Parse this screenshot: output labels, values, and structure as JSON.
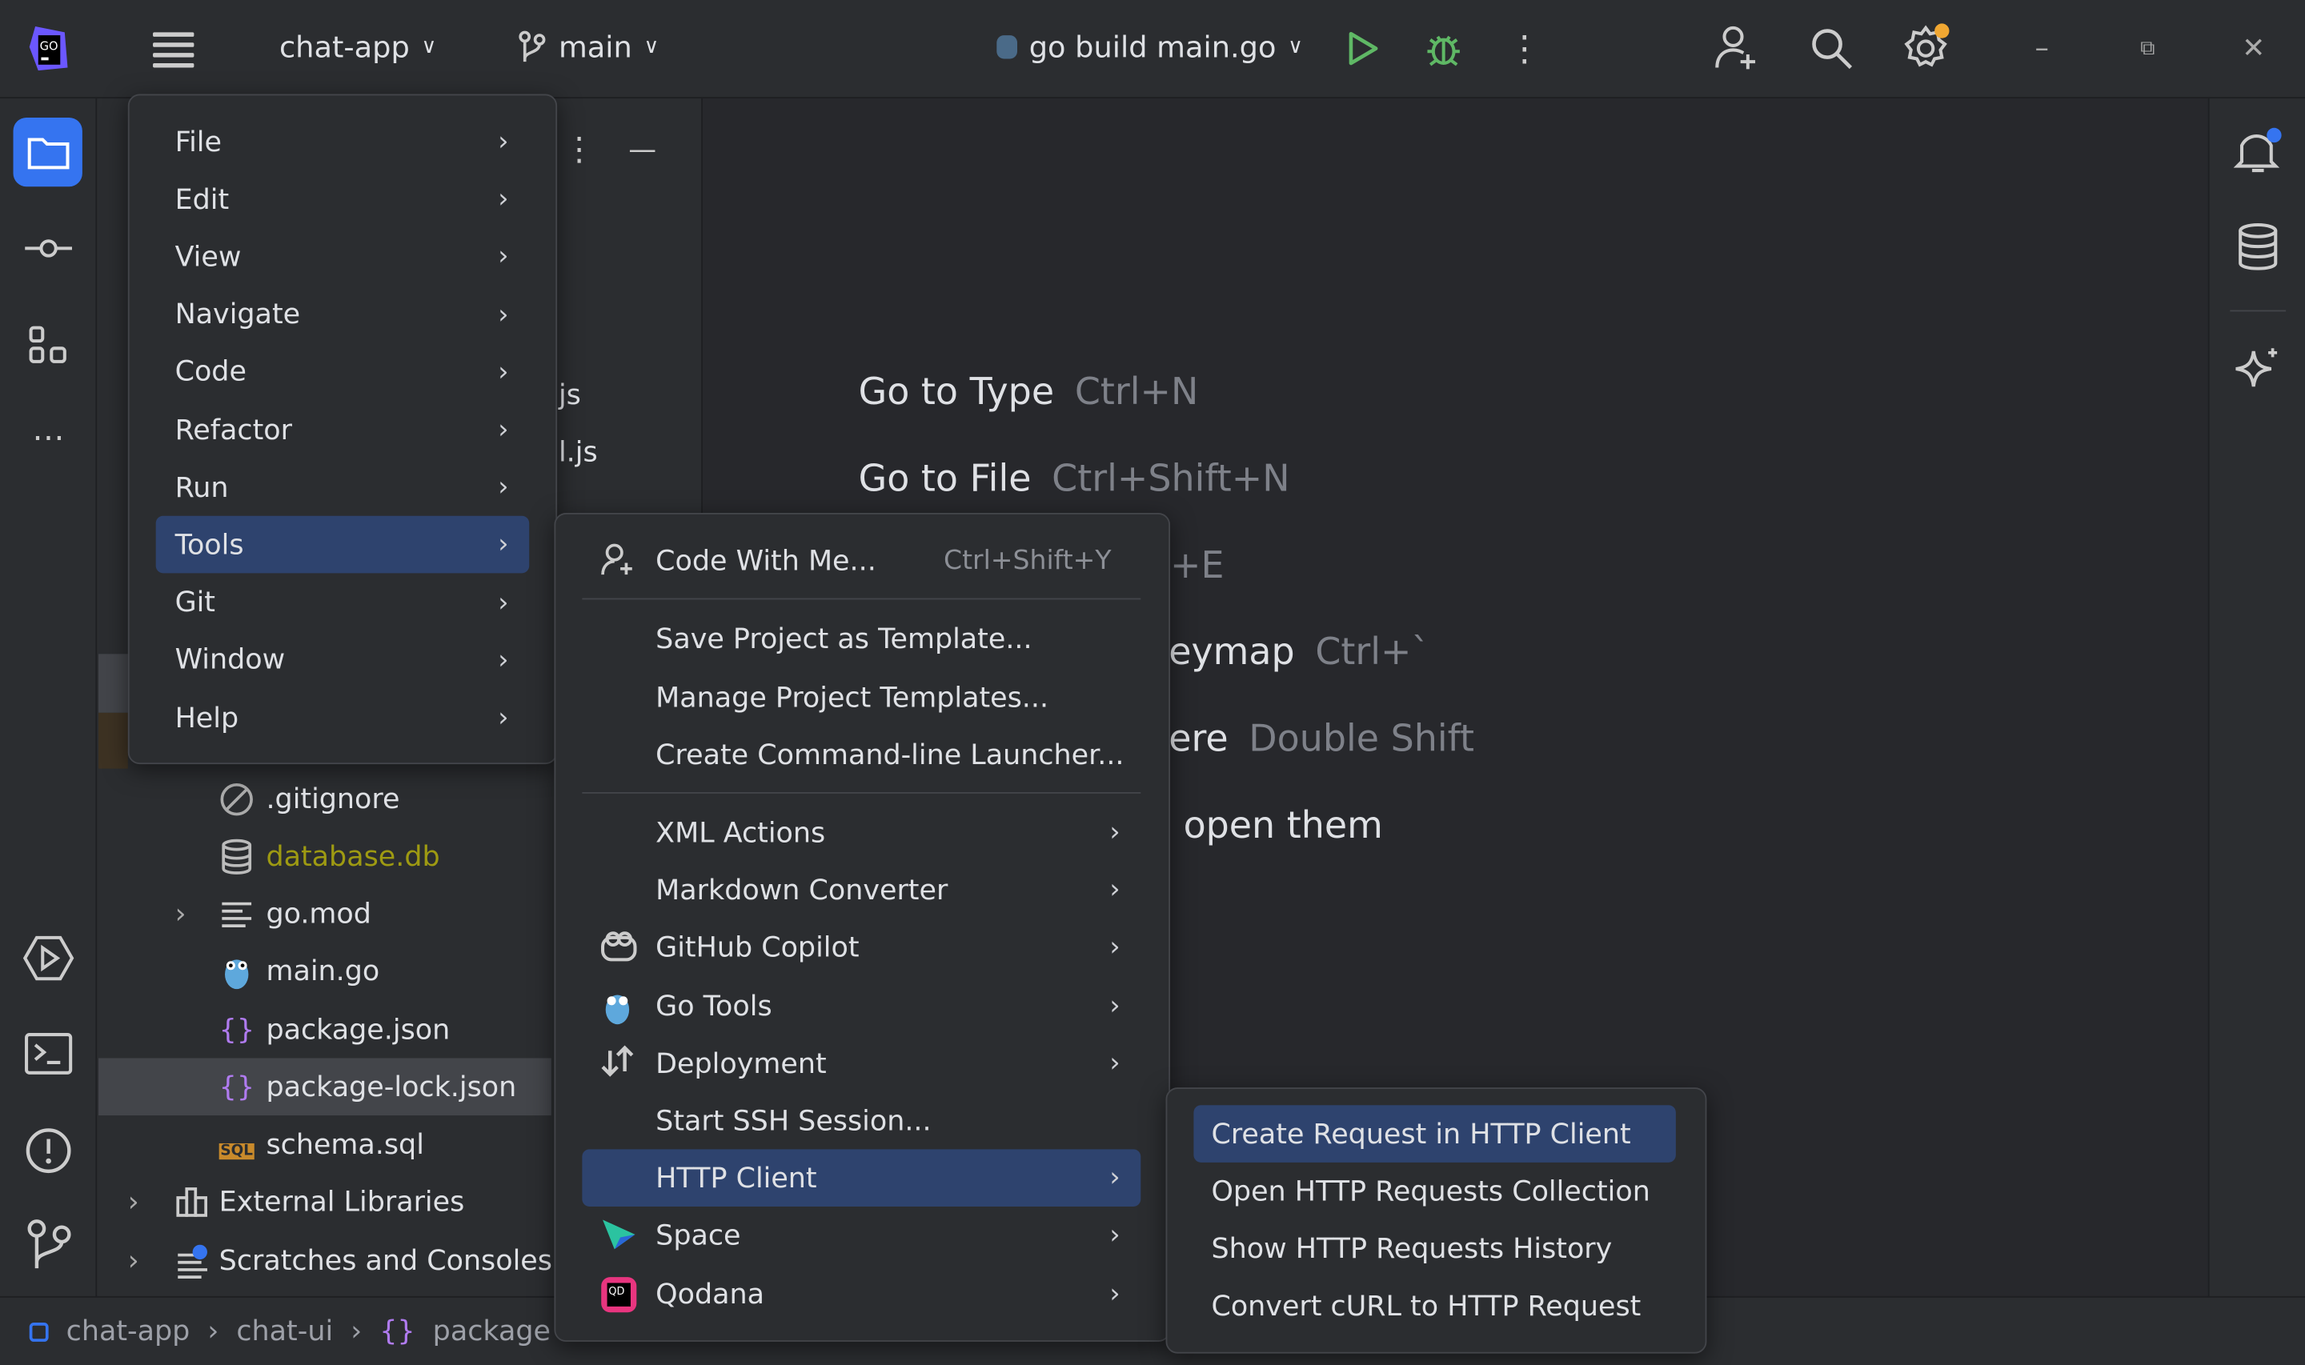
{
  "topbar": {
    "project": "chat-app",
    "branch": "main",
    "run_config": "go build main.go"
  },
  "main_menu": {
    "items": [
      {
        "label": "File"
      },
      {
        "label": "Edit"
      },
      {
        "label": "View"
      },
      {
        "label": "Navigate"
      },
      {
        "label": "Code"
      },
      {
        "label": "Refactor"
      },
      {
        "label": "Run"
      },
      {
        "label": "Tools",
        "selected": true
      },
      {
        "label": "Git"
      },
      {
        "label": "Window"
      },
      {
        "label": "Help"
      }
    ]
  },
  "tools_menu": {
    "items": [
      {
        "label": "Code With Me...",
        "shortcut": "Ctrl+Shift+Y",
        "icon": "add-user-icon"
      },
      {
        "label": "Save Project as Template..."
      },
      {
        "label": "Manage Project Templates..."
      },
      {
        "label": "Create Command-line Launcher..."
      },
      {
        "label": "XML Actions",
        "submenu": true
      },
      {
        "label": "Markdown Converter",
        "submenu": true
      },
      {
        "label": "GitHub Copilot",
        "submenu": true,
        "icon": "copilot-icon"
      },
      {
        "label": "Go Tools",
        "submenu": true,
        "icon": "gopher-icon"
      },
      {
        "label": "Deployment",
        "submenu": true,
        "icon": "deployment-icon"
      },
      {
        "label": "Start SSH Session..."
      },
      {
        "label": "HTTP Client",
        "submenu": true,
        "selected": true
      },
      {
        "label": "Space",
        "submenu": true,
        "icon": "space-icon"
      },
      {
        "label": "Qodana",
        "submenu": true,
        "icon": "qodana-icon"
      }
    ]
  },
  "http_menu": {
    "items": [
      {
        "label": "Create Request in HTTP Client",
        "selected": true
      },
      {
        "label": "Open HTTP Requests Collection"
      },
      {
        "label": "Show HTTP Requests History"
      },
      {
        "label": "Convert cURL to HTTP Request"
      }
    ]
  },
  "project_tree": {
    "partial": [
      "js",
      "l.js"
    ],
    "items": [
      {
        "label": ".gitignore"
      },
      {
        "label": "database.db",
        "color": "#9e9a12"
      },
      {
        "label": "go.mod"
      },
      {
        "label": "main.go"
      },
      {
        "label": "package.json"
      },
      {
        "label": "package-lock.json",
        "selected": true
      },
      {
        "label": "schema.sql"
      },
      {
        "label": "External Libraries"
      },
      {
        "label": "Scratches and Consoles"
      }
    ]
  },
  "editor_hints": [
    {
      "text": "Go to Type",
      "key": "Ctrl+N"
    },
    {
      "text": "Go to File",
      "key": "Ctrl+Shift+N"
    },
    {
      "text": "",
      "key": "+E"
    },
    {
      "text": "eymap",
      "key": "Ctrl+`"
    },
    {
      "text": "ere",
      "key": "Double Shift"
    },
    {
      "text": "open them",
      "key": ""
    }
  ],
  "breadcrumb": [
    "chat-app",
    "chat-ui",
    "package"
  ],
  "colors": {
    "selection": "#2e436e",
    "accent": "#3574f0",
    "json": "#b07bf0"
  }
}
